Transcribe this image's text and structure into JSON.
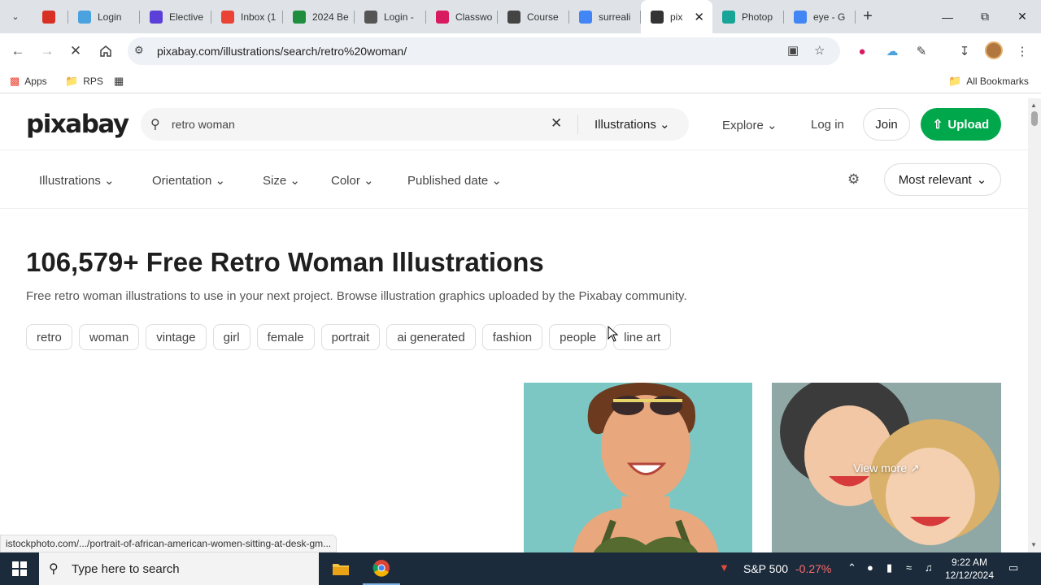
{
  "browser": {
    "tabs": [
      {
        "label": "",
        "icon": "record-icon",
        "color": "#d93025"
      },
      {
        "label": "Login",
        "icon": "cloud-icon",
        "color": "#4aa3df"
      },
      {
        "label": "Elective",
        "icon": "video-icon",
        "color": "#5b3fd9"
      },
      {
        "label": "Inbox (1",
        "icon": "gmail-icon",
        "color": "#ea4335"
      },
      {
        "label": "2024 Be",
        "icon": "leaf-icon",
        "color": "#1e8e3e"
      },
      {
        "label": "Login -",
        "icon": "chart-icon",
        "color": "#555555"
      },
      {
        "label": "Classwo",
        "icon": "classroom-icon",
        "color": "#d81b60"
      },
      {
        "label": "Course",
        "icon": "globe-icon",
        "color": "#444444"
      },
      {
        "label": "surreali",
        "icon": "google-icon",
        "color": "#4285f4"
      },
      {
        "label": "pix",
        "icon": "pixabay-icon",
        "color": "#333333",
        "active": true
      },
      {
        "label": "Photop",
        "icon": "photopea-icon",
        "color": "#18a497"
      },
      {
        "label": "eye - G",
        "icon": "google-icon",
        "color": "#4285f4"
      }
    ],
    "url": "pixabay.com/illustrations/search/retro%20woman/",
    "bookmarks": {
      "apps": "Apps",
      "rps": "RPS",
      "all": "All Bookmarks"
    },
    "status_url": "istockphoto.com/.../portrait-of-african-american-women-sitting-at-desk-gm..."
  },
  "header": {
    "logo": "pixabay",
    "search_value": "retro woman",
    "media_type": "Illustrations",
    "explore": "Explore",
    "login": "Log in",
    "join": "Join",
    "upload": "Upload"
  },
  "filters": {
    "items": [
      "Illustrations",
      "Orientation",
      "Size",
      "Color",
      "Published date"
    ],
    "sort": "Most relevant"
  },
  "main": {
    "title": "106,579+ Free Retro Woman Illustrations",
    "subtitle": "Free retro woman illustrations to use in your next project. Browse illustration graphics uploaded by the Pixabay community.",
    "tags": [
      "retro",
      "woman",
      "vintage",
      "girl",
      "female",
      "portrait",
      "ai generated",
      "fashion",
      "people",
      "line art"
    ],
    "view_more": "View more"
  },
  "taskbar": {
    "search_placeholder": "Type here to search",
    "ticker_name": "S&P 500",
    "ticker_change": "-0.27%",
    "ticker_color": "#ff6b6b",
    "time": "9:22 AM",
    "date": "12/12/2024"
  }
}
